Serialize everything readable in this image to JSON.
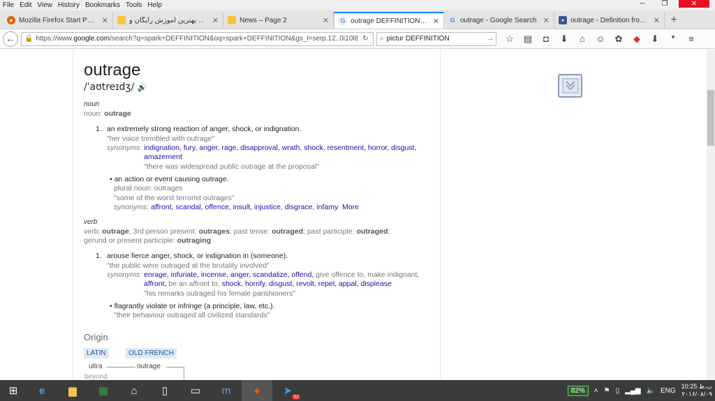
{
  "menu": [
    "File",
    "Edit",
    "View",
    "History",
    "Bookmarks",
    "Tools",
    "Help"
  ],
  "tabs": [
    {
      "title": "Mozilla Firefox Start Page",
      "icon": "firefox-icon",
      "active": false
    },
    {
      "title": "بهترین آموزش رایگان و ...",
      "icon": "folder-icon",
      "active": false
    },
    {
      "title": "News – Page 2",
      "icon": "folder-icon",
      "active": false
    },
    {
      "title": "outrage DEFFINITION - Go...",
      "icon": "google-icon",
      "active": true
    },
    {
      "title": "outrage - Google Search",
      "icon": "google-icon",
      "active": false
    },
    {
      "title": "outrage - Definition from ...",
      "icon": "site-icon",
      "active": false
    }
  ],
  "url": {
    "prefix": "https://www.",
    "host": "google.com",
    "rest": "/search?q=spark+DEFFINITION&oq=spark+DEFFINITION&gs_l=serp.12..0i10l8.124681.1253!"
  },
  "search": {
    "value": "pictur DEFFINITION"
  },
  "entry": {
    "word": "outrage",
    "phonetic": "/ˈaʊtreɪdʒ/",
    "noun": {
      "label": "noun",
      "form_prefix": "noun:",
      "form_word": "outrage",
      "def1": "an extremely strong reaction of anger, shock, or indignation.",
      "ex1": "\"her voice trembled with outrage\"",
      "syn_label": "synonyms:",
      "syn1": "indignation, fury, anger, rage, disapproval, wrath, shock, resentment, horror, disgust,",
      "syn1b": "amazement",
      "syn1ex": "\"there was widespread public outrage at the proposal\"",
      "sub_def": "an action or event causing outrage.",
      "sub_plural": "plural noun: outrages",
      "sub_ex": "\"some of the worst terrorist outrages\"",
      "sub_syn": "affront, scandal, offence, insult, injustice, disgrace, infamy",
      "more": "More"
    },
    "verb": {
      "label": "verb",
      "forms_a": "verb: ",
      "forms_a_w": "outrage",
      "forms_b": "; 3rd person present: ",
      "forms_b_w": "outrages",
      "forms_c": "; past tense: ",
      "forms_c_w": "outraged",
      "forms_d": "; past participle: ",
      "forms_d_w": "outraged",
      "forms_e": ";",
      "forms_f": "gerund or present participle: ",
      "forms_f_w": "outraging",
      "def1": "arouse fierce anger, shock, or indignation in (someone).",
      "ex1": "\"the public were outraged at the brutality involved\"",
      "syn_label": "synonyms:",
      "syn1": "enrage, infuriate, incense, anger, scandalize, offend,",
      "syn1_plain": " give offence to, make indignant,",
      "syn1b_a": "affront,",
      "syn1b_plain": " be an affront to,",
      "syn1b_b": " shock, horrify, disgust, revolt, repel, appal, displease",
      "syn1ex": "\"his remarks outraged his female parishioners\"",
      "sub_def": "flagrantly violate or infringe (a principle, law, etc.).",
      "sub_ex": "\"their behaviour outraged all civilized standards\""
    },
    "num": "1.",
    "origin": {
      "title": "Origin",
      "lang1": "LATIN",
      "lang2": "OLD FRENCH",
      "w1": "ultra",
      "w2": "outrage",
      "w3": "beyond"
    }
  },
  "tray": {
    "battery": "82%",
    "lang": "ENG",
    "time": "10:25 ب.ظ",
    "date": "۲۰۱۶/۰۸/۰۹"
  },
  "taskbar_badge": "52"
}
